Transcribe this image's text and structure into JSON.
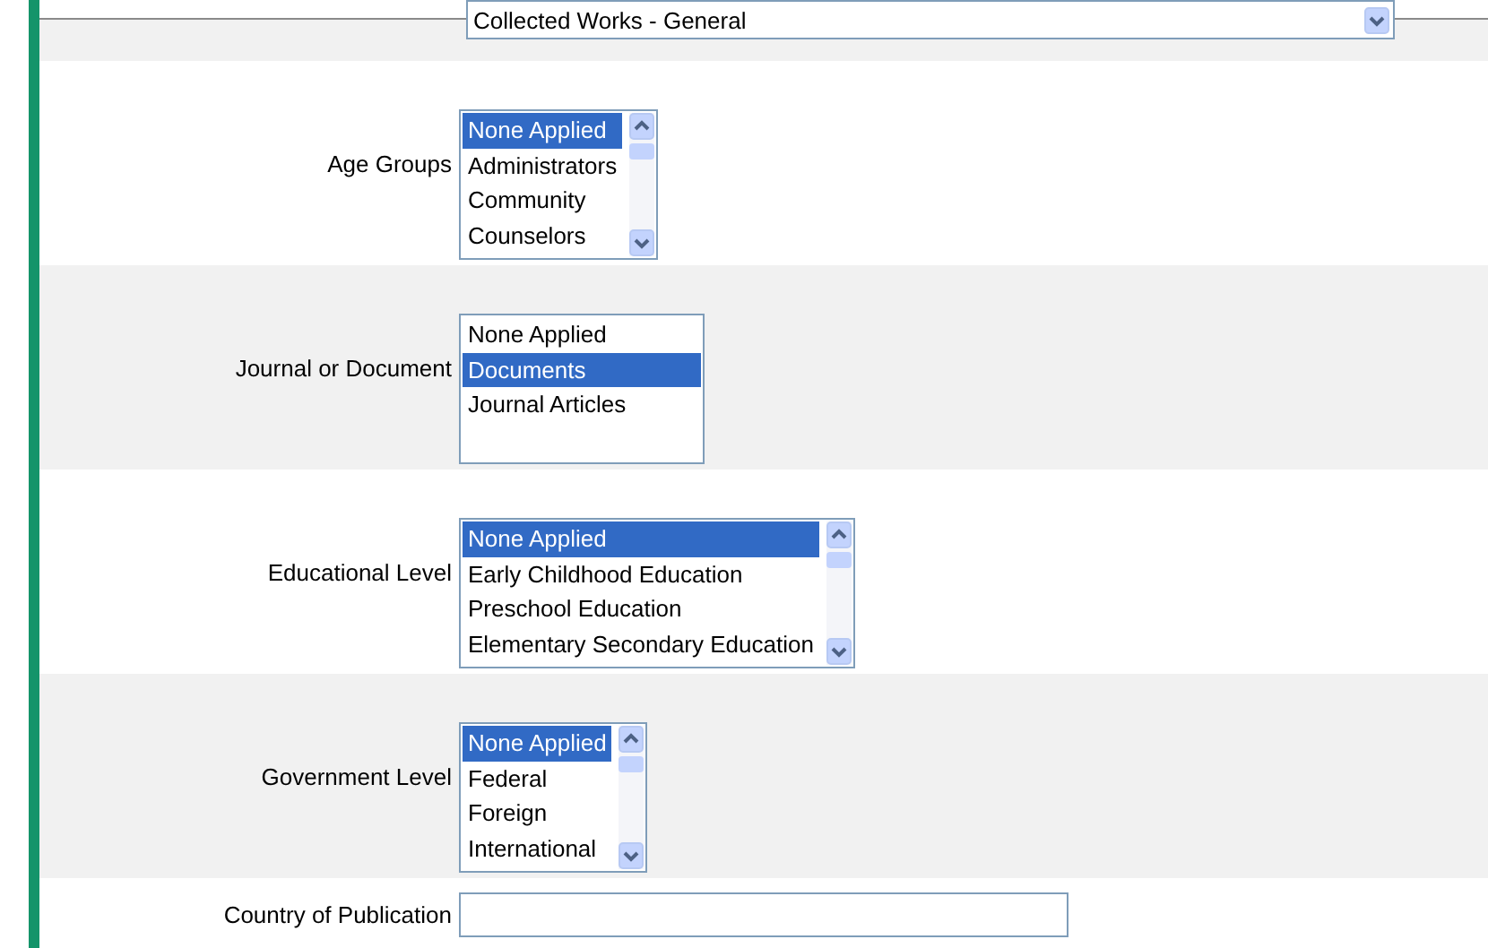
{
  "top_select": {
    "value": "Collected Works - General"
  },
  "fields": [
    {
      "label": "Age Groups",
      "kind": "listbox",
      "items": [
        {
          "text": "None Applied",
          "selected": true
        },
        {
          "text": "Administrators",
          "selected": false
        },
        {
          "text": "Community",
          "selected": false
        },
        {
          "text": "Counselors",
          "selected": false
        }
      ]
    },
    {
      "label": "Journal or Document",
      "kind": "listbox",
      "items": [
        {
          "text": "None Applied",
          "selected": false
        },
        {
          "text": "Documents",
          "selected": true
        },
        {
          "text": "Journal Articles",
          "selected": false
        }
      ]
    },
    {
      "label": "Educational Level",
      "kind": "listbox",
      "items": [
        {
          "text": "None Applied",
          "selected": true
        },
        {
          "text": "Early Childhood Education",
          "selected": false
        },
        {
          "text": "Preschool Education",
          "selected": false
        },
        {
          "text": "Elementary Secondary Education",
          "selected": false
        }
      ]
    },
    {
      "label": "Government Level",
      "kind": "listbox",
      "items": [
        {
          "text": "None Applied",
          "selected": true
        },
        {
          "text": "Federal",
          "selected": false
        },
        {
          "text": "Foreign",
          "selected": false
        },
        {
          "text": "International",
          "selected": false
        }
      ]
    },
    {
      "label": "Country of Publication",
      "kind": "text"
    }
  ]
}
